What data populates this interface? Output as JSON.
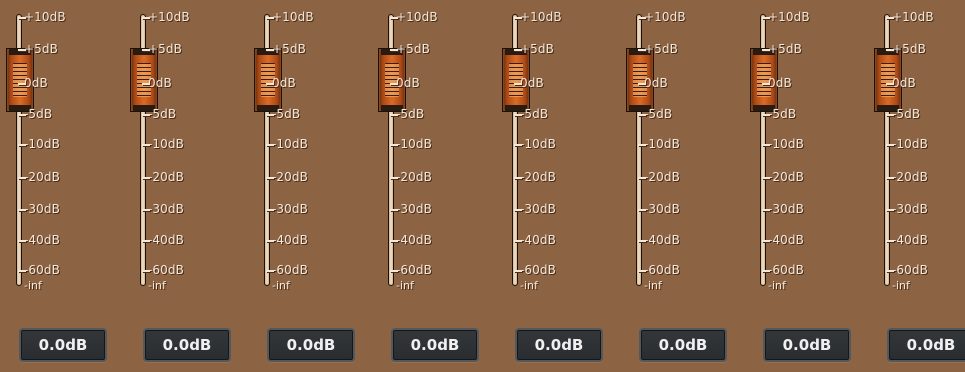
{
  "scale_labels": [
    "+10dB",
    "+5dB",
    "0dB",
    "-5dB",
    "-10dB",
    "-20dB",
    "-30dB",
    "-40dB",
    "-60dB",
    "-inf"
  ],
  "channels": [
    {
      "value": "0.0dB",
      "level_db": 0
    },
    {
      "value": "0.0dB",
      "level_db": 0
    },
    {
      "value": "0.0dB",
      "level_db": 0
    },
    {
      "value": "0.0dB",
      "level_db": 0
    },
    {
      "value": "0.0dB",
      "level_db": 0
    },
    {
      "value": "0.0dB",
      "level_db": 0
    },
    {
      "value": "0.0dB",
      "level_db": 0
    },
    {
      "value": "0.0dB",
      "level_db": 0
    }
  ],
  "colors": {
    "background": "#8c6443",
    "slider_thumb": "#da6b26",
    "value_box": "#2f3336",
    "scale_text": "#f5e8db"
  }
}
